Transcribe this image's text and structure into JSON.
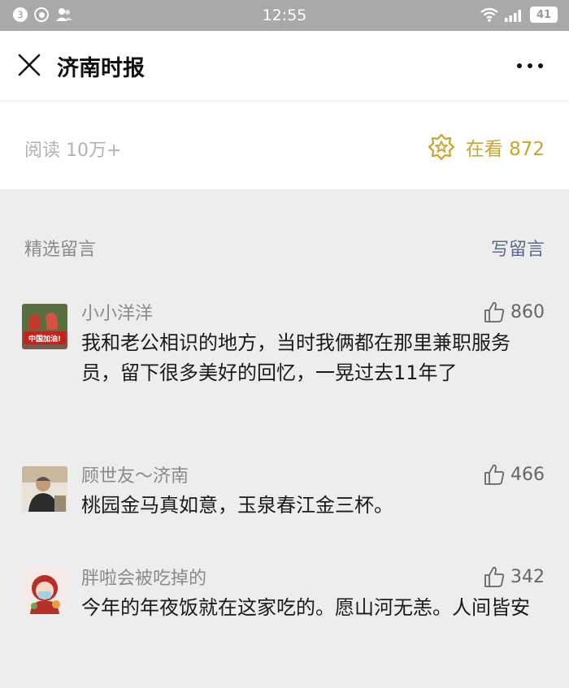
{
  "status_bar": {
    "notification_count": "3",
    "time": "12:55",
    "battery": "41"
  },
  "header": {
    "title": "济南时报"
  },
  "stats": {
    "read_count": "阅读 10万+",
    "watching_label": "在看 872"
  },
  "comments_section": {
    "title": "精选留言",
    "write_label": "写留言",
    "comments": [
      {
        "nickname": "小小洋洋",
        "likes": "860",
        "text": "我和老公相识的地方，当时我俩都在那里兼职服务员，留下很多美好的回忆，一晃过去11年了",
        "avatar_caption": "中国加油!"
      },
      {
        "nickname": "顾世友～济南",
        "likes": "466",
        "text": "桃园金马真如意，玉泉春江金三杯。"
      },
      {
        "nickname": "胖啦会被吃掉的",
        "likes": "342",
        "text": "今年的年夜饭就在这家吃的。愿山河无恙。人间皆安"
      }
    ]
  },
  "colors": {
    "status_bar_bg": "#a9a9a9",
    "watching_gold": "#c9a530",
    "link_blue": "#5a6a8f",
    "page_bg": "#ededed"
  },
  "icons": {
    "close": "close-icon",
    "more": "more-dots-icon",
    "watching": "wow-star-icon",
    "like": "thumbs-up-icon"
  }
}
